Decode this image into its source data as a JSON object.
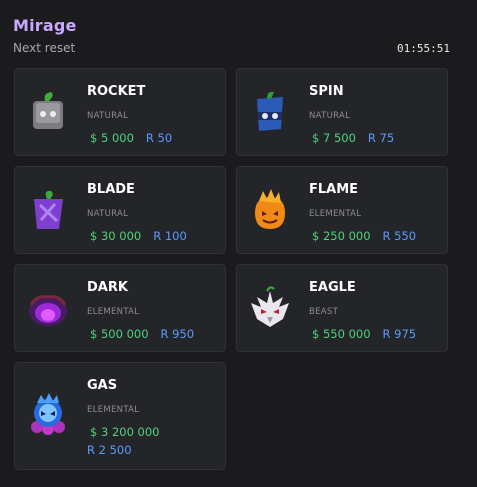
{
  "header": {
    "title": "Mirage",
    "subtitle": "Next reset",
    "timer": "01:55:51"
  },
  "cards": [
    {
      "name": "ROCKET",
      "type": "NATURAL",
      "money": "$ 5 000",
      "robux": "R 50",
      "icon": "rocket-fruit-icon"
    },
    {
      "name": "SPIN",
      "type": "NATURAL",
      "money": "$ 7 500",
      "robux": "R 75",
      "icon": "spin-fruit-icon"
    },
    {
      "name": "BLADE",
      "type": "NATURAL",
      "money": "$ 30 000",
      "robux": "R 100",
      "icon": "blade-fruit-icon"
    },
    {
      "name": "FLAME",
      "type": "ELEMENTAL",
      "money": "$ 250 000",
      "robux": "R 550",
      "icon": "flame-fruit-icon"
    },
    {
      "name": "DARK",
      "type": "ELEMENTAL",
      "money": "$ 500 000",
      "robux": "R 950",
      "icon": "dark-fruit-icon"
    },
    {
      "name": "EAGLE",
      "type": "BEAST",
      "money": "$ 550 000",
      "robux": "R 975",
      "icon": "eagle-fruit-icon"
    },
    {
      "name": "GAS",
      "type": "ELEMENTAL",
      "money": "$ 3 200 000",
      "robux": "R 2 500",
      "icon": "gas-fruit-icon"
    }
  ],
  "colors": {
    "title": "#c9a8ff",
    "money": "#4ed37b",
    "robux": "#5b9bff"
  }
}
